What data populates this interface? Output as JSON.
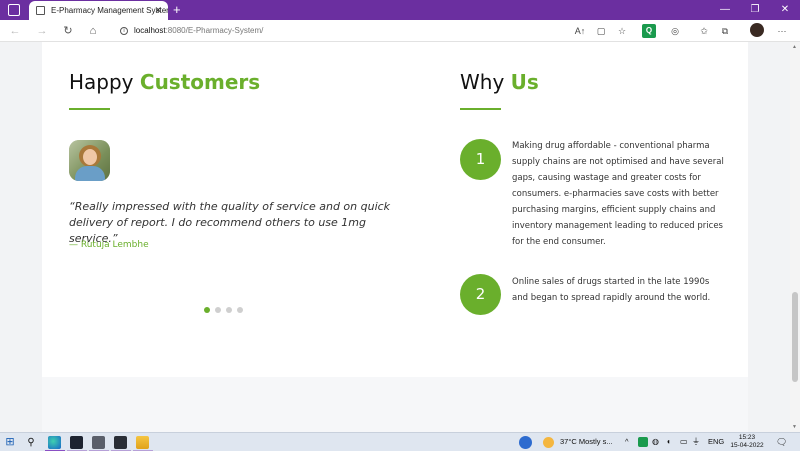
{
  "browser": {
    "tab_title": "E-Pharmacy Management System",
    "tab_close": "✕",
    "new_tab": "+",
    "window_controls": {
      "minimize": "—",
      "restore": "❐",
      "close": "✕"
    },
    "url_host": "localhost",
    "url_rest": ":8080/E-Pharmacy-System/",
    "nav": {
      "back": "←",
      "forward": "→",
      "reload": "↻",
      "home": "⌂"
    },
    "tools": {
      "read_aloud": "A↑",
      "app_available": "▢",
      "favorite": "☆",
      "extension": "Q",
      "refresh_ext": "◎",
      "favorites": "✩",
      "collections": "⧉",
      "more": "···"
    }
  },
  "page": {
    "customers_heading": {
      "plain": "Happy ",
      "accent": "Customers"
    },
    "why_heading": {
      "plain": "Why ",
      "accent": "Us"
    },
    "testimonial": {
      "quote": "“Really impressed with the quality of service and on quick delivery of report. I do recommend others to use 1mg service.”",
      "author": "— Rutuja Lembhe"
    },
    "carousel": {
      "total_slides": 4,
      "active_index": 0
    },
    "reasons": [
      {
        "number": "1",
        "text": "Making drug affordable - conventional pharma supply chains are not optimised and have several gaps, causing wastage and greater costs for consumers. e-pharmacies save costs with better purchasing margins, efficient supply chains and inventory management leading to reduced prices for the end consumer."
      },
      {
        "number": "2",
        "text": "Online sales of drugs started in the late 1990s and began to spread rapidly around the world."
      }
    ]
  },
  "taskbar": {
    "start": "⊞",
    "search": "⚲",
    "weather": "37°C  Mostly s...",
    "tray_arrow": "^",
    "language": "ENG",
    "time": "15:23",
    "date": "15-04-2022",
    "notifications": "🗨"
  },
  "colors": {
    "accent": "#6aaf2c",
    "titlebar": "#6b2fa0"
  }
}
